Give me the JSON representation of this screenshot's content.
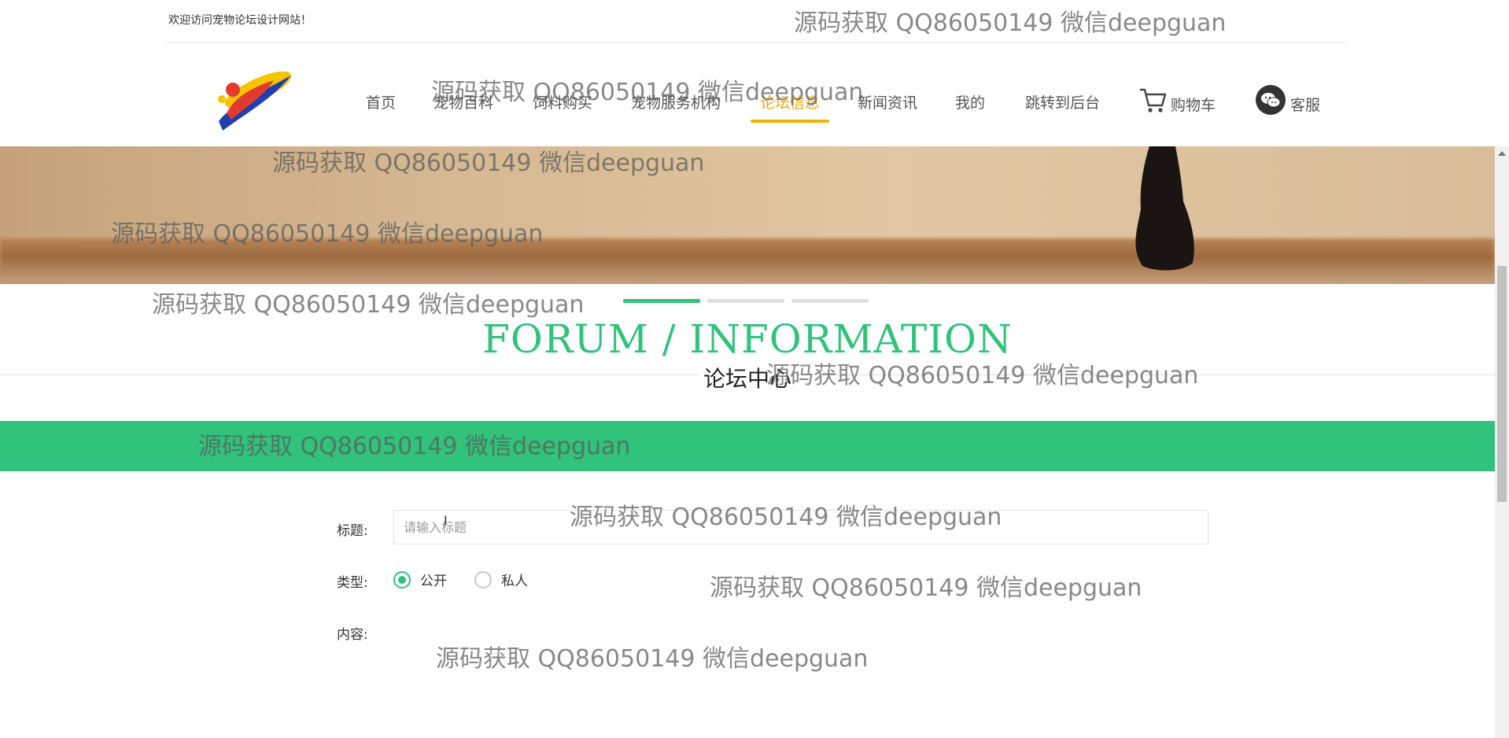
{
  "topbar": {
    "welcome": "欢迎访问宠物论坛设计网站！"
  },
  "nav": {
    "items": [
      {
        "label": "首页"
      },
      {
        "label": "宠物百科"
      },
      {
        "label": "饲料购买"
      },
      {
        "label": "宠物服务机构"
      },
      {
        "label": "论坛信息",
        "active": true
      },
      {
        "label": "新闻资讯"
      },
      {
        "label": "我的"
      },
      {
        "label": "跳转到后台"
      }
    ],
    "cart_label": "购物车",
    "cart_icon": "cart-icon",
    "service_label": "客服",
    "service_icon": "wechat-icon",
    "active_color": "#f0a800"
  },
  "section": {
    "title_en": "FORUM / INFORMATION",
    "title_cn": "论坛中心",
    "accent_color": "#31c27c"
  },
  "form": {
    "title_label": "标题:",
    "title_placeholder": "请输入标题",
    "title_value": "",
    "type_label": "类型:",
    "type_options": [
      {
        "label": "公开",
        "checked": true
      },
      {
        "label": "私人",
        "checked": false
      }
    ],
    "content_label": "内容:"
  },
  "watermark": {
    "text": "源码获取 QQ86050149 微信deepguan"
  }
}
